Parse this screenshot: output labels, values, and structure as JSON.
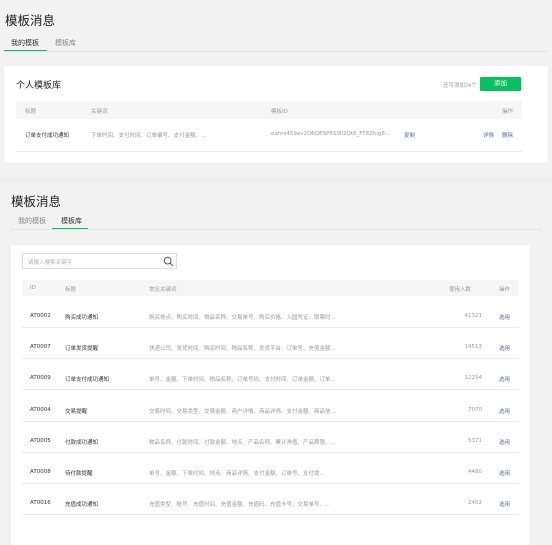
{
  "top": {
    "title": "模板消息",
    "tabs": [
      {
        "label": "我的模板"
      },
      {
        "label": "模板库"
      }
    ],
    "card": {
      "title": "个人模板库",
      "limit_text": "还可添加24个",
      "add_button": "添加",
      "columns": [
        "标题",
        "关键词",
        "模板ID",
        "操作"
      ],
      "row": {
        "title": "订单支付成功通知",
        "keywords": "下单时间、支付时间、订单编号、支付金额、...",
        "template_id": "eahrs459ev2D6QESP6S0Il2Qt6_FT8Zhig8...",
        "copy": "复制",
        "detail": "详情",
        "delete": "删除"
      }
    }
  },
  "bottom": {
    "title": "模板消息",
    "tabs": [
      {
        "label": "我的模板"
      },
      {
        "label": "模板库"
      }
    ],
    "search_placeholder": "请输入搜索关键字",
    "columns": [
      "ID",
      "标题",
      "常见关键词",
      "使用人数",
      "操作"
    ],
    "rows": [
      {
        "id": "AT0002",
        "title": "购买成功通知",
        "keywords": "购买地点、购买时间、物品名称、交易单号、购买价格、入园凭证、取票时...",
        "users": "41321",
        "action": "选用"
      },
      {
        "id": "AT0007",
        "title": "订单发货提醒",
        "keywords": "快递公司、发货时间、购买时间、物品名称、发货平台、订单号、充值金额...",
        "users": "14513",
        "action": "选用"
      },
      {
        "id": "AT0009",
        "title": "订单支付成功通知",
        "keywords": "单号、金额、下单时间、物品名称、订单号码、支付时间、订单金额、订单...",
        "users": "12254",
        "action": "选用"
      },
      {
        "id": "AT0004",
        "title": "交易提醒",
        "keywords": "交易时间、交易类型、交易金额、商户详情、商品详情、支付金额、商品信...",
        "users": "7070",
        "action": "选用"
      },
      {
        "id": "AT0005",
        "title": "付款成功通知",
        "keywords": "物品名称、付款时间、付款金额、地点、产品名称、累计净值、产品期限、...",
        "users": "5371",
        "action": "选用"
      },
      {
        "id": "AT0008",
        "title": "待付款提醒",
        "keywords": "单号、金额、下单时间、地点、商品详情、支付金额、订单号、支付提...",
        "users": "4480",
        "action": "选用"
      },
      {
        "id": "AT0016",
        "title": "充值成功通知",
        "keywords": "充值类型、帐号、充值时间、充值金额、充值码、充值卡号、交易单号、...",
        "users": "2402",
        "action": "选用"
      }
    ]
  },
  "colors": {
    "accent": "#07c160",
    "link": "#576b95"
  }
}
